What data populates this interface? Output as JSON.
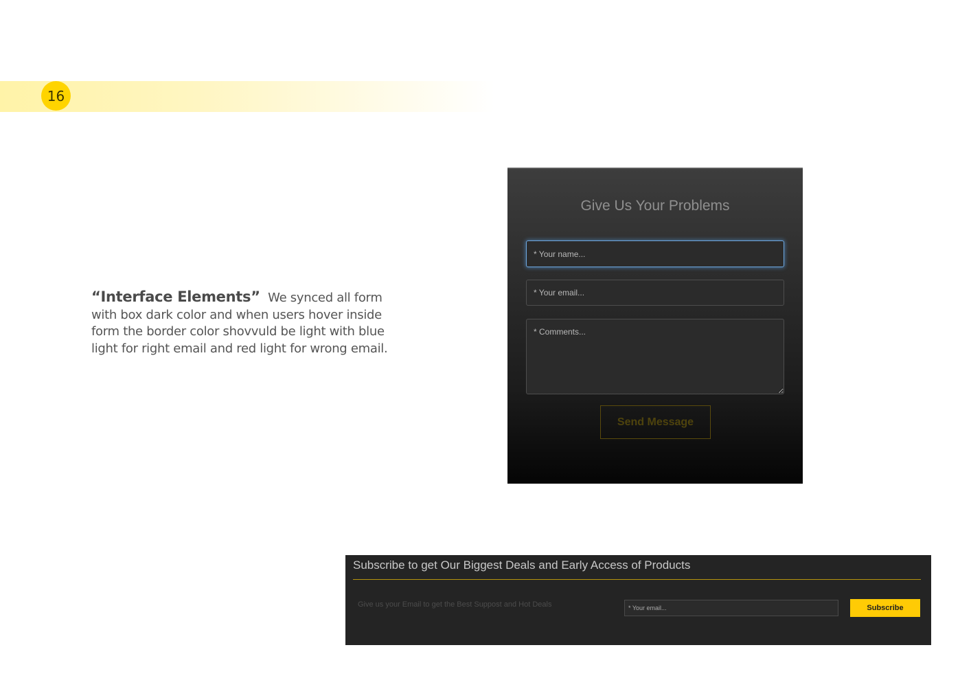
{
  "page": {
    "number": "16",
    "accent_color": "#ffd400"
  },
  "description": {
    "title": "“Interface Elements”",
    "body": "We synced all form with box dark color and when users hover inside form  the border color shovvuld be light with blue light for right email and red light for wrong email."
  },
  "contact_form": {
    "title": "Give Us Your Problems",
    "name_placeholder": "* Your name...",
    "email_placeholder": "* Your email...",
    "comments_placeholder": "* Comments...",
    "send_label": "Send Message",
    "focus_color": "#6ea8e0"
  },
  "subscribe": {
    "title": "Subscribe to get Our Biggest Deals and Early Access of Products",
    "text": "Give us your Email to get the Best Suppost and Hot Deals",
    "email_placeholder": "* Your email...",
    "button_label": "Subscribe",
    "button_color": "#ffcb05"
  }
}
